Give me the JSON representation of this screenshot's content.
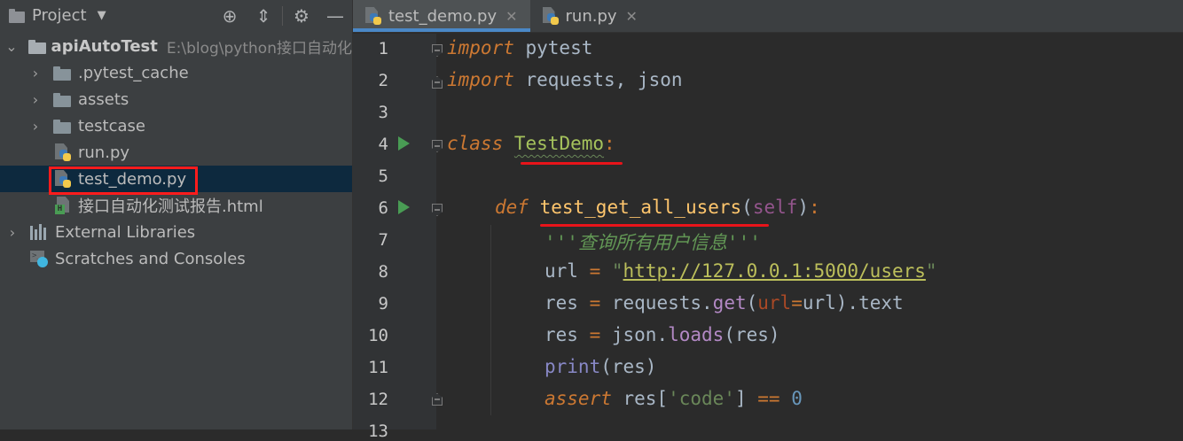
{
  "project_panel": {
    "title": "Project",
    "caret": "▼",
    "tools": {
      "locate": "⊕",
      "collapse": "⇕",
      "settings": "⚙",
      "hide": "—"
    },
    "tree": {
      "root": {
        "name": "apiAutoTest",
        "path": "E:\\blog\\python接口自动化"
      },
      "folders": [
        ".pytest_cache",
        "assets",
        "testcase"
      ],
      "files": [
        "run.py",
        "test_demo.py",
        "接口自动化测试报告.html"
      ],
      "external_libraries": "External Libraries",
      "scratches": "Scratches and Consoles"
    },
    "selected_file": "test_demo.py"
  },
  "editor": {
    "tabs": [
      {
        "label": "test_demo.py",
        "active": true,
        "close": "✕"
      },
      {
        "label": "run.py",
        "active": false,
        "close": "✕"
      }
    ],
    "line_numbers": [
      "1",
      "2",
      "3",
      "4",
      "5",
      "6",
      "7",
      "8",
      "9",
      "10",
      "11",
      "12",
      "13"
    ],
    "code": {
      "l1_kw": "import",
      "l1_rest": " pytest",
      "l2_kw": "import",
      "l2_rest": " requests, json",
      "l4_kw": "class",
      "l4_name": "TestDemo",
      "l4_colon": ":",
      "l6_kw": "def",
      "l6_name": "test_get_all_users",
      "l6_open": "(",
      "l6_self": "self",
      "l6_close": ")",
      "l6_colon": ":",
      "l7_doc": "'''查询所有用户信息'''",
      "l8_var": "url",
      "l8_eq": " = ",
      "l8_q1": "\"",
      "l8_url": "http://127.0.0.1:5000/users",
      "l8_q2": "\"",
      "l9_a": "res",
      "l9_eq": " = ",
      "l9_b": "requests.",
      "l9_m": "get",
      "l9_c": "(",
      "l9_p": "url",
      "l9_eq2": "=",
      "l9_d": "url).text",
      "l10_a": "res",
      "l10_eq": " = ",
      "l10_b": "json.",
      "l10_m": "loads",
      "l10_c": "(res)",
      "l11_fn": "print",
      "l11_rest": "(res)",
      "l12_kw": "assert",
      "l12_a": " res[",
      "l12_s": "'code'",
      "l12_b": "] ",
      "l12_op": "==",
      "l12_sp": " ",
      "l12_n": "0"
    }
  },
  "colors": {
    "annotation_red": "#e8141a",
    "selection_bg": "#0d293e",
    "active_tab_underline": "#4a88c7"
  }
}
